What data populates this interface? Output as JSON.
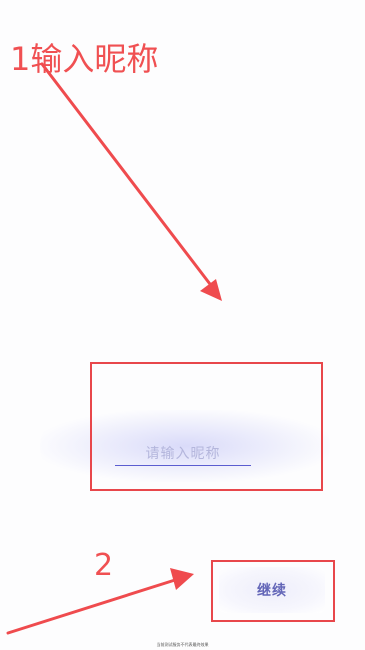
{
  "annotations": {
    "step1": "1输入昵称",
    "step2": "2",
    "color": "#f05052"
  },
  "nickname": {
    "placeholder": "请输入昵称",
    "value": ""
  },
  "continue_button": {
    "label": "继续"
  },
  "footer": {
    "note": "当前测试服务不代表最终效果"
  }
}
